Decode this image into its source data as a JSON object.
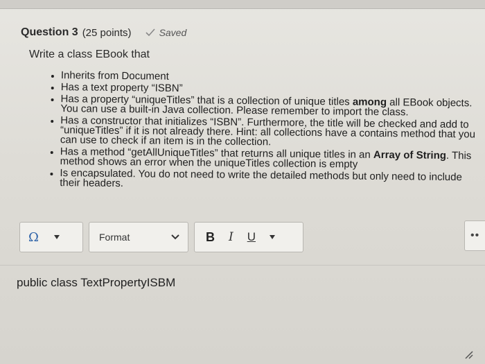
{
  "question": {
    "title": "Question 3",
    "points": "(25 points)",
    "saved_label": "Saved"
  },
  "prompt": "Write a class EBook that",
  "requirements": [
    {
      "text": "Inherits from Document"
    },
    {
      "text": "Has a text property “ISBN”"
    },
    {
      "pre": "Has a property “uniqueTitles” that is a collection of unique titles ",
      "bold": "among",
      "post": " all EBook objects. You can use a built-in Java collection. Please remember to import the class."
    },
    {
      "text": "Has a constructor that initializes “ISBN”. Furthermore, the title will be checked and add to “uniqueTitles” if it is not already there. Hint: all collections have a contains method that you can use to check if an item is in the collection."
    },
    {
      "pre": "Has a method “getAllUniqueTitles” that returns all unique titles in an ",
      "bold": "Array of String",
      "post": ". This method shows an error when the uniqueTitles collection is empty"
    },
    {
      "text": "Is encapsulated. You do not need to write the detailed methods but only need to include their headers."
    }
  ],
  "toolbar": {
    "special_char_glyph": "Ω",
    "format_label": "Format",
    "bold_label": "B",
    "italic_label": "I",
    "underline_label": "U",
    "more_label": "••"
  },
  "editor": {
    "content": "public class TextPropertyISBM"
  },
  "colors": {
    "accent": "#2f63a8"
  }
}
